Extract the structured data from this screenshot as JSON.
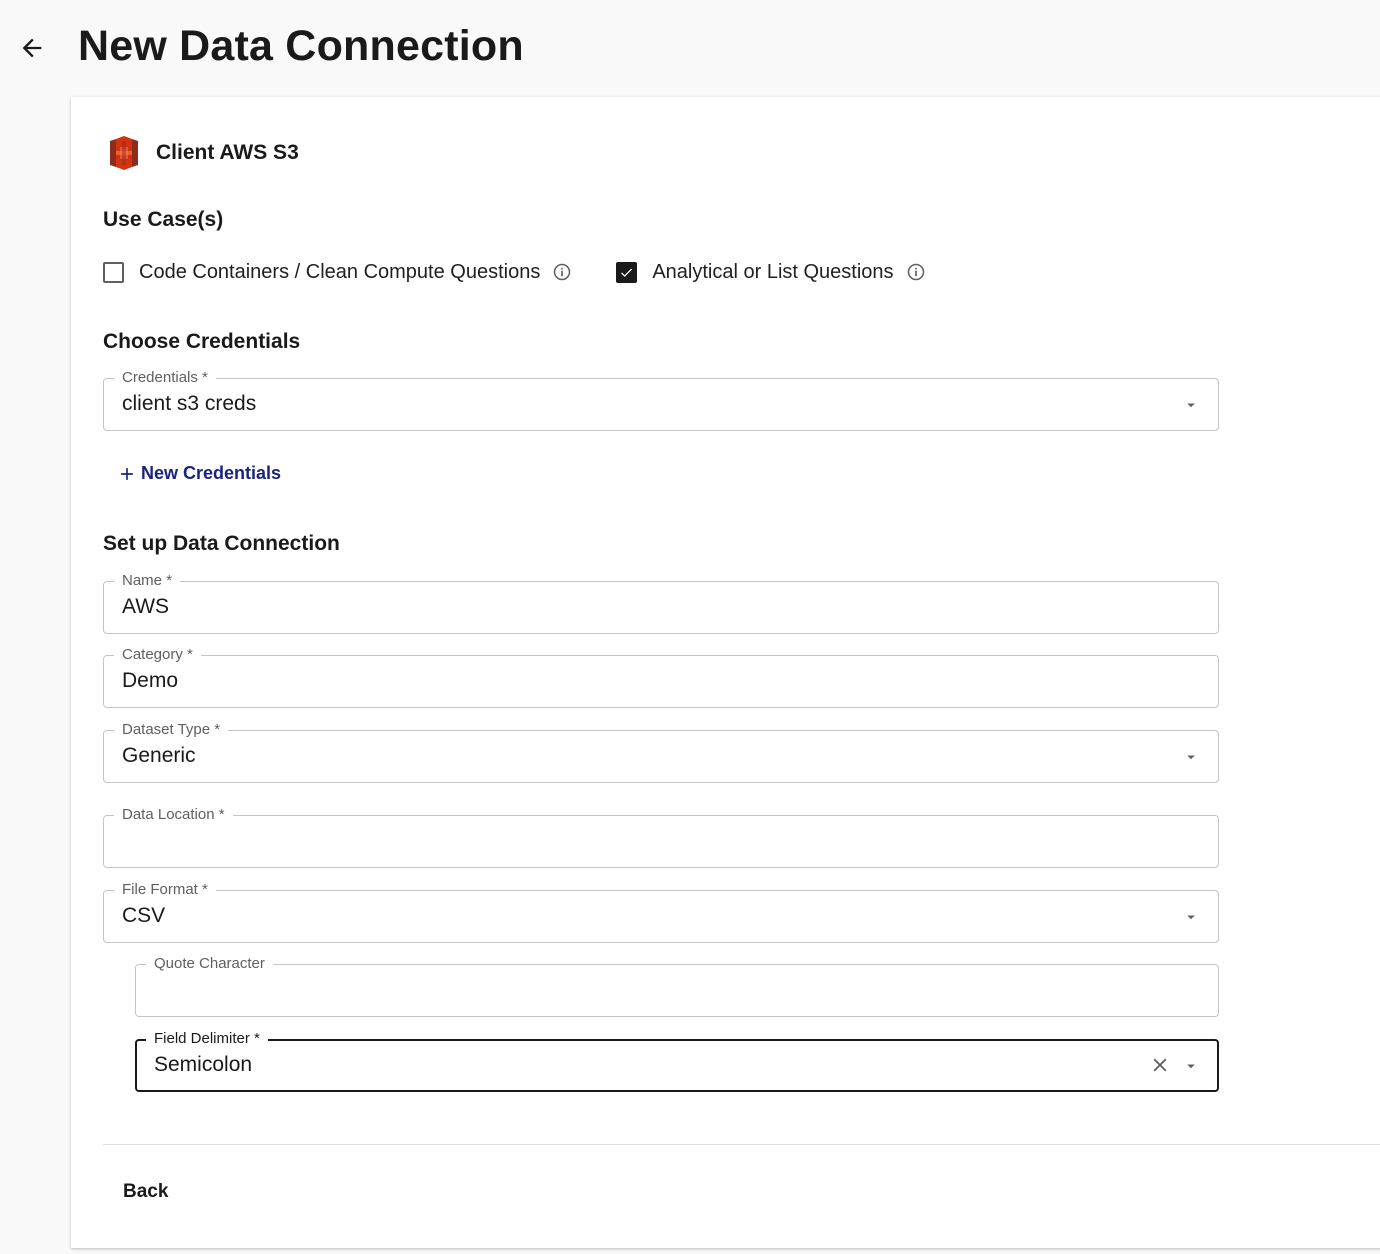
{
  "header": {
    "title": "New Data Connection"
  },
  "source": {
    "name": "Client AWS S3",
    "logo_icon": "aws-s3-logo"
  },
  "use_cases": {
    "title": "Use Case(s)",
    "options": [
      {
        "label": "Code Containers / Clean Compute Questions",
        "checked": false
      },
      {
        "label": "Analytical or List Questions",
        "checked": true
      }
    ]
  },
  "credentials_section": {
    "title": "Choose Credentials",
    "credentials": {
      "label": "Credentials",
      "required": "*",
      "value": "client s3 creds"
    },
    "new_credentials_label": "New Credentials"
  },
  "setup_section": {
    "title": "Set up Data Connection",
    "name": {
      "label": "Name",
      "required": "*",
      "value": "AWS"
    },
    "category": {
      "label": "Category",
      "required": "*",
      "value": "Demo"
    },
    "dataset_type": {
      "label": "Dataset Type",
      "required": "*",
      "value": "Generic"
    },
    "data_location": {
      "label": "Data Location",
      "required": "*",
      "value": ""
    },
    "file_format": {
      "label": "File Format",
      "required": "*",
      "value": "CSV"
    },
    "quote_character": {
      "label": "Quote Character",
      "value": ""
    },
    "field_delimiter": {
      "label": "Field Delimiter",
      "required": "*",
      "value": "Semicolon"
    }
  },
  "footer": {
    "back_label": "Back"
  },
  "colors": {
    "accent": "#1a237e",
    "text": "#1a1a1a",
    "border": "#c4c4c4",
    "s3_red": "#d13212"
  }
}
